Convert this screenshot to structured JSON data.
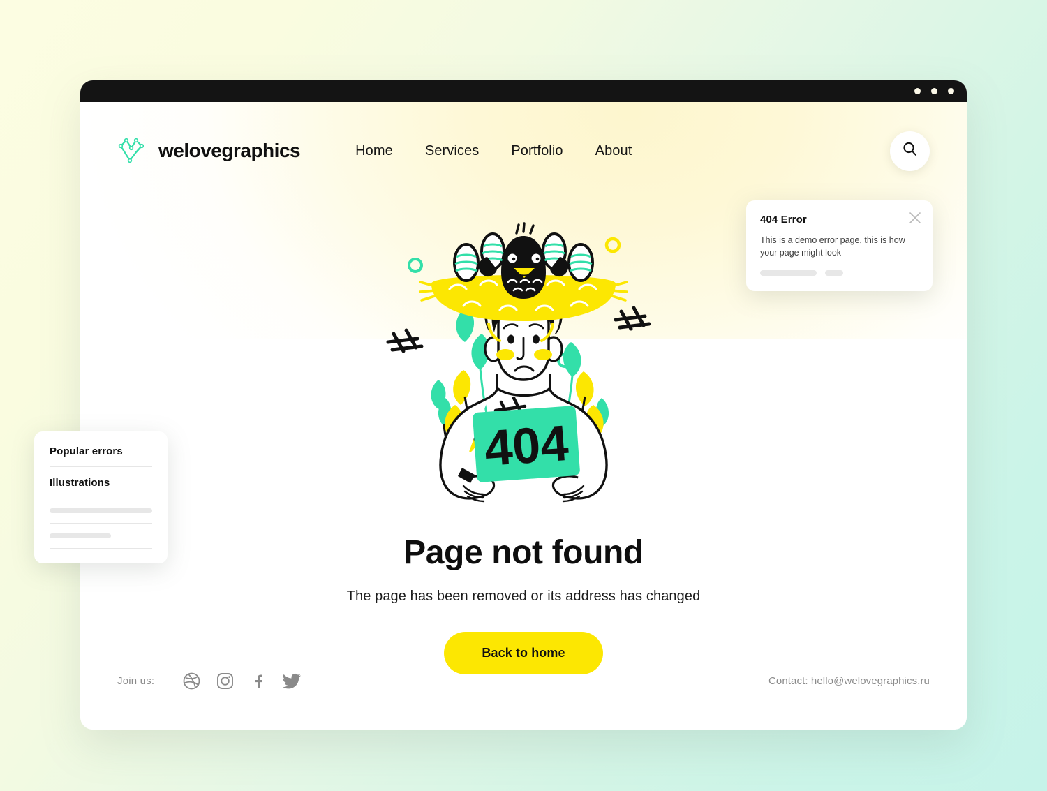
{
  "window": {
    "dots_count": 3
  },
  "header": {
    "brand_name": "welovegraphics",
    "brand_mark_icon": "mountain-logo-icon",
    "nav": [
      {
        "label": "Home"
      },
      {
        "label": "Services"
      },
      {
        "label": "Portfolio"
      },
      {
        "label": "About"
      }
    ],
    "search_icon": "search-icon"
  },
  "illustration": {
    "sign_text": "404",
    "alt": "Sad person with a bird nest on their head holding a 404 sign"
  },
  "hero": {
    "title": "Page not found",
    "subtitle": "The page has been removed or its address has changed",
    "cta_label": "Back to home"
  },
  "footer": {
    "join_label": "Join us:",
    "socials": [
      {
        "name": "dribbble-icon",
        "label": "Dribbble"
      },
      {
        "name": "instagram-icon",
        "label": "Instagram"
      },
      {
        "name": "facebook-icon",
        "label": "Facebook"
      },
      {
        "name": "twitter-icon",
        "label": "Twitter"
      }
    ],
    "contact": "Contact: hello@welovegraphics.ru"
  },
  "left_card": {
    "row1": "Popular errors",
    "row2": "Illustrations"
  },
  "error_card": {
    "title": "404 Error",
    "body": "This is a demo error page, this is how your page might look",
    "close_icon": "close-icon"
  },
  "colors": {
    "accent_yellow": "#FCE702",
    "accent_mint": "#33DFA9",
    "ink": "#111111",
    "bg_gradient_start": "#FCFDE2",
    "bg_gradient_end": "#C6F3E9",
    "titlebar": "#141414",
    "muted_text": "#8A8A8A"
  }
}
